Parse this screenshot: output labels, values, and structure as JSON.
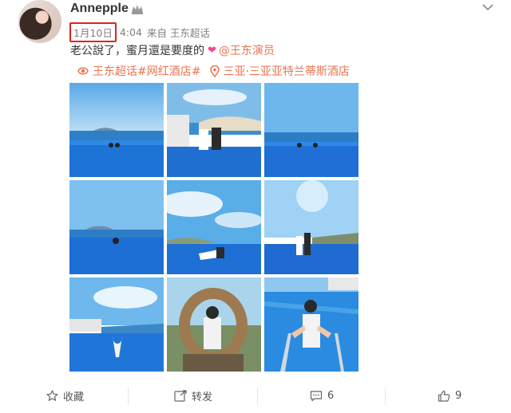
{
  "post": {
    "username": "Annepple",
    "date": "1月10日",
    "time": "4:04",
    "source": "来自 王东超话",
    "text_main": "老公說了，蜜月還是要度的",
    "mention": "@王东演员",
    "tag_topic": "王东超话#网红酒店#",
    "tag_location": "三亚·三亚亚特兰蒂斯酒店"
  },
  "actions": {
    "favorite": "收藏",
    "repost": "转发",
    "comment_count": "6",
    "like_count": "9"
  },
  "colors": {
    "link": "#eb7350",
    "highlight_box": "#e0221b"
  }
}
